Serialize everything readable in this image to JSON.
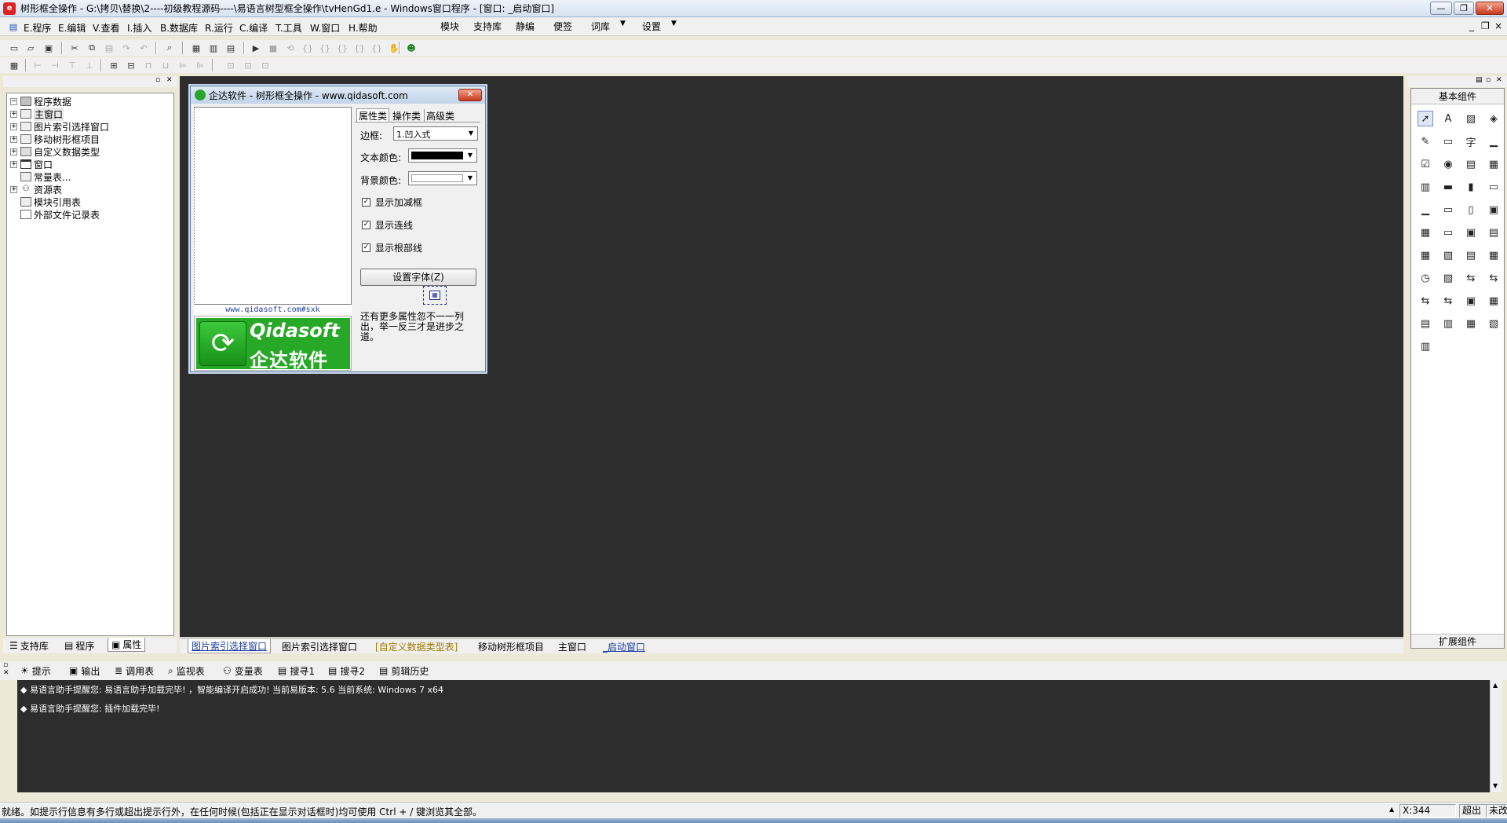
{
  "window": {
    "title": "树形框全操作 - G:\\拷贝\\替换\\2----初级教程源码----\\易语言树型框全操作\\tvHenGd1.e - Windows窗口程序 - [窗口: _启动窗口]",
    "app_icon": "e-app-icon",
    "minimize_label": "—",
    "restore_label": "❐",
    "close_label": "✕"
  },
  "menubar": {
    "items": [
      "E.程序",
      "E.编辑",
      "V.查看",
      "I.插入",
      "B.数据库",
      "R.运行",
      "C.编译",
      "T.工具",
      "W.窗口",
      "H.帮助"
    ],
    "right_items": [
      "模块",
      "支持库",
      "静编",
      "便签",
      "词库",
      "设置"
    ],
    "mdi_minimize": "_",
    "mdi_restore": "❐",
    "mdi_close": "×"
  },
  "left_panel": {
    "root": "程序数据",
    "items": [
      {
        "label": "主窗口",
        "expandable": true,
        "selected": true
      },
      {
        "label": "图片索引选择窗口",
        "expandable": true
      },
      {
        "label": "移动树形框项目",
        "expandable": true
      },
      {
        "label": "自定义数据类型",
        "expandable": true
      },
      {
        "label": "窗口",
        "expandable": true
      },
      {
        "label": "常量表...",
        "expandable": false
      },
      {
        "label": "资源表",
        "expandable": true
      },
      {
        "label": "模块引用表",
        "expandable": false
      },
      {
        "label": "外部文件记录表",
        "expandable": false
      }
    ],
    "tabs": [
      "支持库",
      "程序",
      "属性"
    ]
  },
  "dialog": {
    "title": "企达软件 - 树形框全操作 - www.qidasoft.com",
    "tabs": [
      "属性类",
      "操作类",
      "高级类"
    ],
    "border_label": "边框:",
    "border_value": "1.凹入式",
    "text_color_label": "文本颜色:",
    "back_color_label": "背景颜色:",
    "checkboxes": [
      "显示加减框",
      "显示连线",
      "显示根部线"
    ],
    "font_button": "设置字体(Z)",
    "hint_text": "还有更多属性忽不一一列出，举一反三才是进步之道。",
    "url_text": "www.qidasoft.com#sxk",
    "logo_en": "Qidasoft",
    "logo_cn": "企达软件"
  },
  "editor_tabs": [
    "图片索引选择窗口",
    "图片索引选择窗口",
    "[自定义数据类型表]",
    "移动树形框项目",
    "主窗口",
    "_启动窗口"
  ],
  "palette": {
    "title": "基本组件",
    "footer": "扩展组件"
  },
  "output_tabs": [
    "提示",
    "输出",
    "调用表",
    "监视表",
    "变量表",
    "搜寻1",
    "搜寻2",
    "剪辑历史"
  ],
  "output_lines": [
    "◆ 易语言助手提醒您: 易语言助手加载完毕!  ，智能编译开启成功!  当前易版本: 5.6  当前系统: Windows 7 x64",
    "◆ 易语言助手提醒您: 插件加载完毕!"
  ],
  "statusbar": {
    "message": "就绪。如提示行信息有多行或超出提示行外，在任何时候(包括正在显示对话框时)均可使用 Ctrl + / 键浏览其全部。",
    "coord": "X:344",
    "overwrite": "超出",
    "saved": "未改"
  }
}
